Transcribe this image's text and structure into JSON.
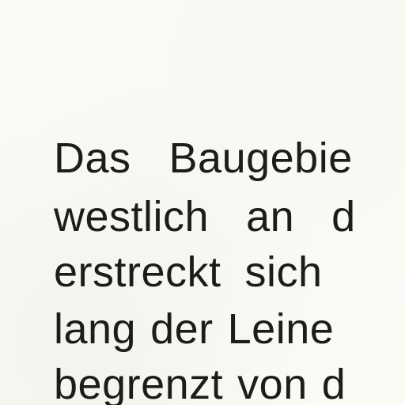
{
  "document": {
    "lines": [
      [
        "Das",
        "Baugebie"
      ],
      [
        "westlich",
        "an",
        "d"
      ],
      [
        "erstreckt",
        "sich"
      ],
      [
        "lang",
        "der",
        "Leine"
      ],
      [
        "begrenzt",
        "von",
        "d"
      ]
    ]
  }
}
